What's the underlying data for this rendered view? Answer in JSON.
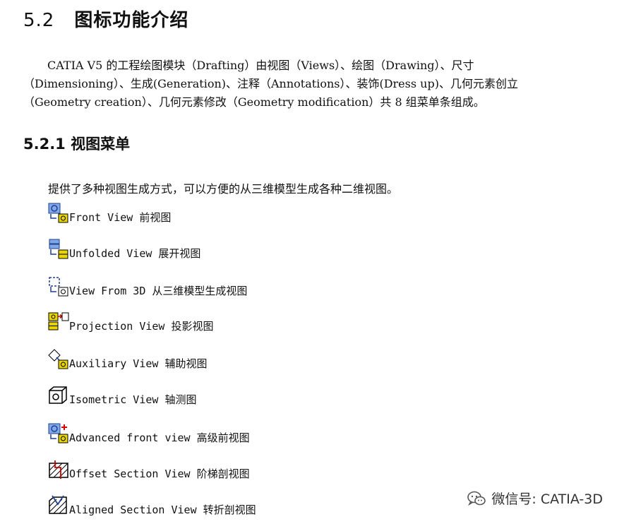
{
  "section": {
    "number": "5.2",
    "title": "图标功能介绍"
  },
  "paragraph": "CATIA V5 的工程绘图模块（Drafting）由视图（Views）、绘图（Drawing）、尺寸（Dimensioning）、生成(Generation)、注释（Annotations）、装饰(Dress up)、几何元素创立（Geometry creation）、几何元素修改（Geometry modification）共 8 组菜单条组成。",
  "subsection": {
    "number": "5.2.1",
    "title": "视图菜单"
  },
  "intro": "提供了多种视图生成方式，可以方便的从三维模型生成各种二维视图。",
  "items": [
    {
      "en": "Front View",
      "zh": "前视图",
      "icon": "front-view-icon"
    },
    {
      "en": "Unfolded View",
      "zh": "展开视图",
      "icon": "unfolded-view-icon"
    },
    {
      "en": "View From 3D",
      "zh": "从三维模型生成视图",
      "icon": "view-from-3d-icon"
    },
    {
      "en": "Projection View",
      "zh": "投影视图",
      "icon": "projection-view-icon"
    },
    {
      "en": "Auxiliary View",
      "zh": "辅助视图",
      "icon": "auxiliary-view-icon"
    },
    {
      "en": "Isometric View",
      "zh": "轴测图",
      "icon": "isometric-view-icon"
    },
    {
      "en": "Advanced front view",
      "zh": "高级前视图",
      "icon": "advanced-front-view-icon"
    },
    {
      "en": "Offset Section View",
      "zh": "阶梯剖视图",
      "icon": "offset-section-view-icon"
    },
    {
      "en": "Aligned Section View",
      "zh": "转折剖视图",
      "icon": "aligned-section-view-icon"
    }
  ],
  "watermark": {
    "text": "微信号: CATIA-3D",
    "icon": "wechat-icon"
  }
}
